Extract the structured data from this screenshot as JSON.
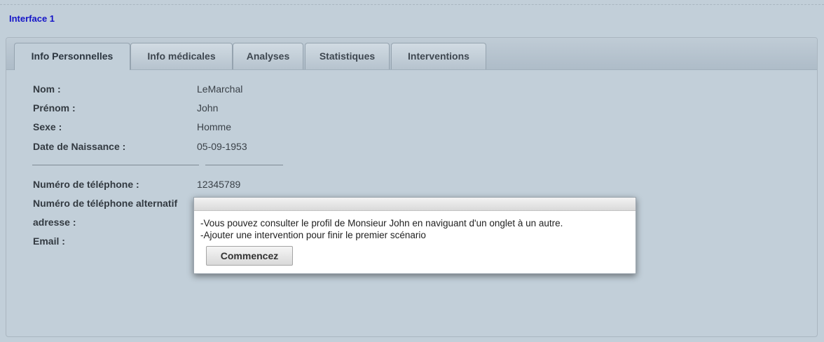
{
  "page": {
    "title": "Interface 1"
  },
  "tabs": [
    {
      "label": "Info Personnelles"
    },
    {
      "label": "Info médicales"
    },
    {
      "label": "Analyses"
    },
    {
      "label": "Statistiques"
    },
    {
      "label": "Interventions"
    }
  ],
  "active_tab": "Info Personnelles",
  "fields": [
    {
      "label": "Nom :",
      "value": "LeMarchal"
    },
    {
      "label": "Prénom :",
      "value": "John"
    },
    {
      "label": "Sexe :",
      "value": "Homme"
    },
    {
      "label": "Date de Naissance :",
      "value": "05-09-1953"
    },
    {
      "label": "Numéro de téléphone :",
      "value": "12345789"
    },
    {
      "label": "Numéro de téléphone alternatif",
      "value": ""
    },
    {
      "label": "adresse :",
      "value": ""
    },
    {
      "label": "Email :",
      "value": ""
    }
  ],
  "dialog": {
    "line1": "-Vous pouvez consulter le profil de Monsieur John en naviguant d'un onglet à un autre.",
    "line2": "-Ajouter une intervention pour finir le premier scénario",
    "button_label": "Commencez"
  },
  "colors": {
    "background": "#c2cfd9",
    "title": "#1515c8",
    "tab_text": "#3e4750",
    "dialog_background": "#ffffff"
  }
}
